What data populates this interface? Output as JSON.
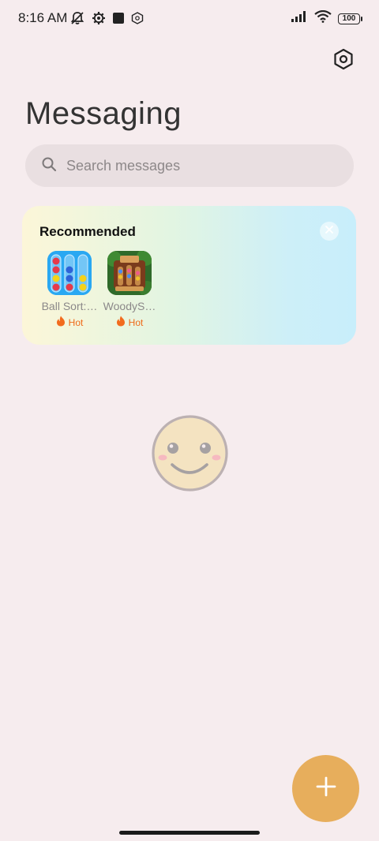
{
  "status_bar": {
    "time": "8:16 AM",
    "battery": "100",
    "icons_left": [
      "muted-bell-icon",
      "settings-gear-icon",
      "square-notification-icon",
      "hexagon-notification-icon"
    ],
    "icons_right": [
      "signal-icon",
      "wifi-icon",
      "battery-icon"
    ]
  },
  "header": {
    "title": "Messaging",
    "settings_icon": "hexagon-settings-icon"
  },
  "search": {
    "placeholder": "Search messages",
    "icon": "search-icon"
  },
  "recommended": {
    "title": "Recommended",
    "close_icon": "close-icon",
    "apps": [
      {
        "name": "Ball Sort:…",
        "badge": "Hot",
        "icon": "ball-sort-app-icon"
      },
      {
        "name": "WoodyS…",
        "badge": "Hot",
        "icon": "woody-sort-app-icon"
      }
    ]
  },
  "empty_state": {
    "icon": "smiley-face-icon"
  },
  "fab": {
    "icon": "plus-icon",
    "color": "#e7ae5c"
  },
  "colors": {
    "background": "#f6ecee",
    "hot": "#ef6a18"
  }
}
